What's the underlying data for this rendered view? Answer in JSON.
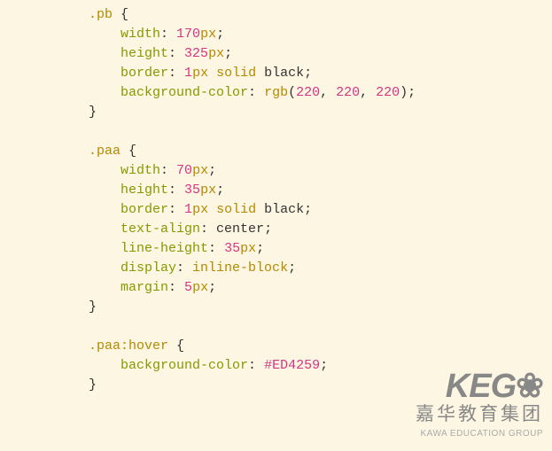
{
  "code": {
    "rule1": {
      "selector": ".pb",
      "p1_prop": "width",
      "p1_num": "170",
      "p1_unit": "px",
      "p2_prop": "height",
      "p2_num": "325",
      "p2_unit": "px",
      "p3_prop": "border",
      "p3_num": "1",
      "p3_unit": "px",
      "p3_solid": "solid",
      "p3_color": "black",
      "p4_prop": "background-color",
      "p4_fn": "rgb",
      "p4_r": "220",
      "p4_g": "220",
      "p4_b": "220"
    },
    "rule2": {
      "selector": ".paa",
      "p1_prop": "width",
      "p1_num": "70",
      "p1_unit": "px",
      "p2_prop": "height",
      "p2_num": "35",
      "p2_unit": "px",
      "p3_prop": "border",
      "p3_num": "1",
      "p3_unit": "px",
      "p3_solid": "solid",
      "p3_color": "black",
      "p4_prop": "text-align",
      "p4_val": "center",
      "p5_prop": "line-height",
      "p5_num": "35",
      "p5_unit": "px",
      "p6_prop": "display",
      "p6_val": "inline-block",
      "p7_prop": "margin",
      "p7_num": "5",
      "p7_unit": "px"
    },
    "rule3": {
      "selector": ".paa:hover",
      "p1_prop": "background-color",
      "p1_hex": "#ED4259"
    }
  },
  "watermark": {
    "logo": "KEG",
    "cn": "嘉华教育集团",
    "en": "KAWA EDUCATION GROUP"
  }
}
